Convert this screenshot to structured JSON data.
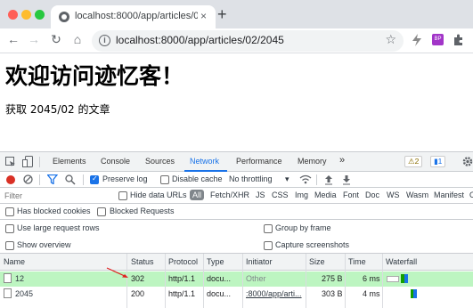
{
  "browser": {
    "tab_title": "localhost:8000/app/articles/02",
    "tab_close": "×",
    "new_tab": "+",
    "back": "←",
    "forward": "→",
    "reload": "↻",
    "home": "⌂",
    "url": "localhost:8000/app/articles/02/2045",
    "star": "☆",
    "colors": {
      "close": "#ff5f57",
      "minimize": "#febc2e",
      "maximize": "#28c840"
    }
  },
  "page": {
    "heading": "欢迎访问迹忆客！",
    "text": "获取 2045/02 的文章"
  },
  "devtools": {
    "tabs": [
      "Elements",
      "Console",
      "Sources",
      "Network",
      "Performance",
      "Memory",
      "»"
    ],
    "active_tab": "Network",
    "issues_badge": "⚠2",
    "messages_badge": "▮1",
    "toolbar": {
      "preserve_log": "Preserve log",
      "disable_cache": "Disable cache",
      "throttling": "No throttling",
      "throttle_arrow": "▾"
    },
    "filter": {
      "placeholder": "Filter",
      "hide_data_urls": "Hide data URLs",
      "all": "All",
      "types": [
        "Fetch/XHR",
        "JS",
        "CSS",
        "Img",
        "Media",
        "Font",
        "Doc",
        "WS",
        "Wasm",
        "Manifest",
        "O"
      ]
    },
    "options": {
      "has_blocked_cookies": "Has blocked cookies",
      "blocked_requests": "Blocked Requests",
      "large_rows": "Use large request rows",
      "group_by_frame": "Group by frame",
      "show_overview": "Show overview",
      "capture_screenshots": "Capture screenshots"
    },
    "columns": [
      "Name",
      "Status",
      "Protocol",
      "Type",
      "Initiator",
      "Size",
      "Time",
      "Waterfall"
    ],
    "rows": [
      {
        "name": "12",
        "status": "302",
        "protocol": "http/1.1",
        "type": "docu...",
        "initiator": "Other",
        "size": "275 B",
        "time": "6 ms"
      },
      {
        "name": "2045",
        "status": "200",
        "protocol": "http/1.1",
        "type": "docu...",
        "initiator": ":8000/app/arti...",
        "size": "303 B",
        "time": "4 ms"
      }
    ]
  }
}
